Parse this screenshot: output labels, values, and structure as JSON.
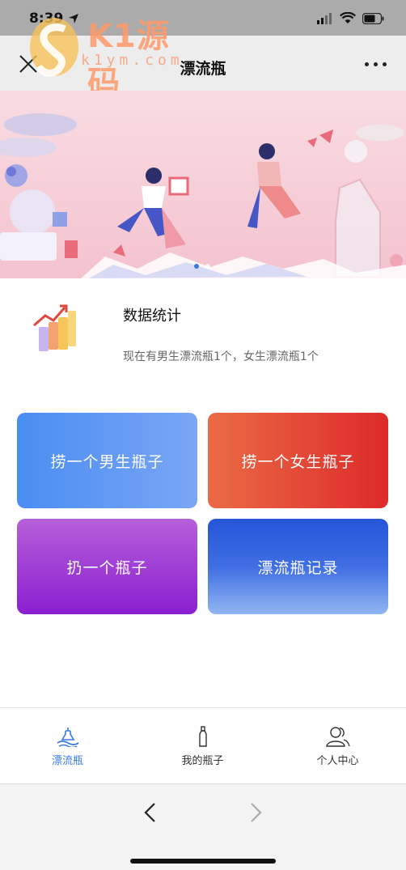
{
  "status_bar": {
    "time": "8:39"
  },
  "nav": {
    "title": "漂流瓶"
  },
  "watermark": {
    "brand": "K1源码",
    "url": "k1ym.com"
  },
  "banner": {
    "carousel_dots": 2,
    "active_dot": 1
  },
  "stats": {
    "title": "数据统计",
    "description": "现在有男生漂流瓶1个，女生漂流瓶1个"
  },
  "actions": {
    "pick_male": "捞一个男生瓶子",
    "pick_female": "捞一个女生瓶子",
    "throw": "扔一个瓶子",
    "records": "漂流瓶记录"
  },
  "tabbar": {
    "items": [
      {
        "label": "漂流瓶",
        "icon": "bottle-wave-icon",
        "active": true
      },
      {
        "label": "我的瓶子",
        "icon": "bottle-icon",
        "active": false
      },
      {
        "label": "个人中心",
        "icon": "users-icon",
        "active": false
      }
    ]
  },
  "colors": {
    "accent": "#3b7be0",
    "male_button": "#4a8df2",
    "female_button": "#e3443a",
    "throw_button": "#a043d6",
    "records_button": "#2d5fdc"
  }
}
